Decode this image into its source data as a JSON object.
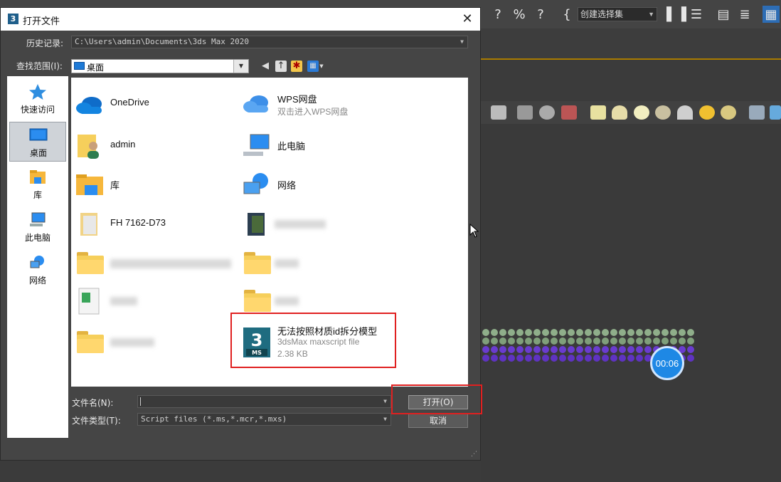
{
  "app": {
    "selection_set_placeholder": "创建选择集",
    "timer": "00:06"
  },
  "dialog": {
    "title": "打开文件",
    "close_glyph": "✕",
    "history_label": "历史记录:",
    "history_value": "C:\\Users\\admin\\Documents\\3ds Max 2020",
    "look_in_label": "查找范围(I):",
    "look_in_value": "桌面"
  },
  "places": [
    {
      "label": "快速访问",
      "icon": "star-icon"
    },
    {
      "label": "桌面",
      "icon": "desktop-icon",
      "active": true
    },
    {
      "label": "库",
      "icon": "library-icon"
    },
    {
      "label": "此电脑",
      "icon": "computer-icon"
    },
    {
      "label": "网络",
      "icon": "network-icon"
    }
  ],
  "files": {
    "onedrive": {
      "name": "OneDrive"
    },
    "wps": {
      "name": "WPS网盘",
      "sub": "双击进入WPS网盘"
    },
    "admin": {
      "name": "admin"
    },
    "thispc": {
      "name": "此电脑"
    },
    "library": {
      "name": "库"
    },
    "network": {
      "name": "网络"
    },
    "fh": {
      "name": "FH 7162-D73"
    },
    "script": {
      "name": "无法按照材质id拆分模型",
      "type": "3dsMax maxscript file",
      "size": "2.38 KB"
    }
  },
  "bottom": {
    "filename_label": "文件名(N):",
    "filename_value": "",
    "filetype_label": "文件类型(T):",
    "filetype_value": "Script files (*.ms,*.mcr,*.mxs)",
    "open_button": "打开(O)",
    "cancel_button": "取消"
  },
  "colors": {
    "highlight": "#e02020",
    "dialog_bg": "#454545",
    "app_bg": "#3b3b3b"
  }
}
